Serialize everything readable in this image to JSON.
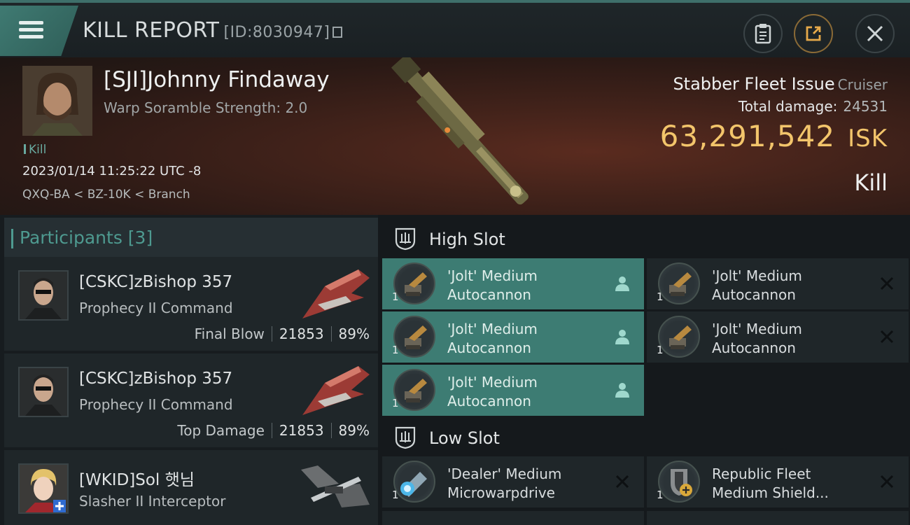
{
  "header": {
    "title": "KILL REPORT",
    "report_id": "[ID:8030947]"
  },
  "victim": {
    "name": "[SJI]Johnny Findaway",
    "warp": "Warp Soramble Strength: 2.0",
    "tag": "Kill",
    "datetime": "2023/01/14 11:25:22 UTC -8",
    "location": "QXQ-BA < BZ-10K < Branch",
    "ship": "Stabber Fleet Issue",
    "ship_class": "Cruiser",
    "total_damage_label": "Total damage:",
    "total_damage": "24531",
    "isk_value": "63,291,542",
    "isk_unit": "ISK",
    "kind": "Kill"
  },
  "participants": {
    "title": "Participants [3]",
    "rows": [
      {
        "name": "[CSKC]zBishop 357",
        "ship": "Prophecy II Command",
        "label": "Final Blow",
        "damage": "21853",
        "pct": "89%"
      },
      {
        "name": "[CSKC]zBishop 357",
        "ship": "Prophecy II Command",
        "label": "Top Damage",
        "damage": "21853",
        "pct": "89%"
      },
      {
        "name": "[WKID]Sol 햇님",
        "ship": "Slasher II Interceptor",
        "label": "",
        "damage": "",
        "pct": ""
      }
    ]
  },
  "slots": {
    "high_title": "High Slot",
    "low_title": "Low Slot",
    "high": [
      {
        "line1": "'Jolt' Medium",
        "line2": "Autocannon",
        "qty": "1"
      },
      {
        "line1": "'Jolt' Medium",
        "line2": "Autocannon",
        "qty": "1"
      },
      {
        "line1": "'Jolt' Medium",
        "line2": "Autocannon",
        "qty": "1"
      },
      {
        "line1": "'Jolt' Medium",
        "line2": "Autocannon",
        "qty": "1"
      },
      {
        "line1": "'Jolt' Medium",
        "line2": "Autocannon",
        "qty": "1"
      }
    ],
    "low": [
      {
        "line1": "'Dealer' Medium",
        "line2": "Microwarpdrive",
        "qty": "1"
      },
      {
        "line1": "Republic Fleet",
        "line2": "Medium Shield...",
        "qty": "1"
      }
    ]
  },
  "colors": {
    "accent": "#3d7c73",
    "isk": "#f3c56b",
    "teal_text": "#4e9a90"
  }
}
